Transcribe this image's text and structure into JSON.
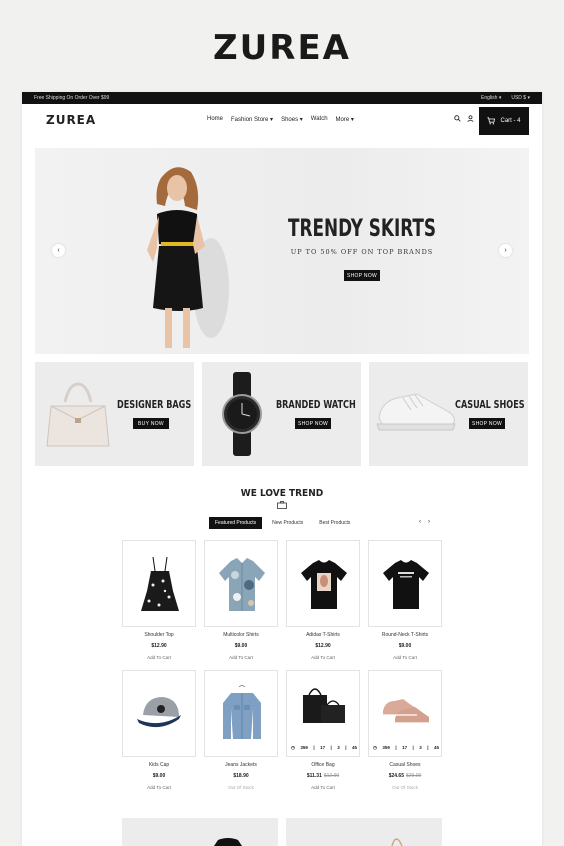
{
  "brand": "ZUREA",
  "topbar": {
    "shipping": "Free Shipping On Order Over $99",
    "language": "English",
    "currency": "USD $"
  },
  "header": {
    "logo": "ZUREA",
    "nav": [
      "Home",
      "Fashion Store",
      "Shoes",
      "Watch",
      "More"
    ],
    "cart_label": "Cart - 4"
  },
  "hero": {
    "title": "TRENDY SKIRTS",
    "subtitle": "UP TO 50% OFF ON TOP BRANDS",
    "button": "SHOP NOW"
  },
  "banners": [
    {
      "title": "DESIGNER BAGS",
      "button": "BUY NOW"
    },
    {
      "title": "BRANDED WATCH",
      "button": "SHOP NOW"
    },
    {
      "title": "CASUAL SHOES",
      "button": "SHOP NOW"
    }
  ],
  "section": {
    "title": "WE LOVE TREND",
    "tabs": [
      "Featured Products",
      "New Products",
      "Best Products"
    ]
  },
  "products": [
    {
      "name": "Shoulder Top",
      "price": "$12.90",
      "old_price": "",
      "action": "Add To Cart"
    },
    {
      "name": "Multicolor Shirts",
      "price": "$9.00",
      "old_price": "",
      "action": "Add To Cart"
    },
    {
      "name": "Adidas T-Shirts",
      "price": "$12.90",
      "old_price": "",
      "action": "Add To Cart"
    },
    {
      "name": "Round-Neck T-Shirts",
      "price": "$9.00",
      "old_price": "",
      "action": "Add To Cart"
    },
    {
      "name": "Kids Cap",
      "price": "$9.00",
      "old_price": "",
      "action": "Add To Cart"
    },
    {
      "name": "Jeans Jackets",
      "price": "$18.90",
      "old_price": "",
      "action": "Out Of Stock"
    },
    {
      "name": "Office Bag",
      "price": "$11.31",
      "old_price": "$12.90",
      "action": "Add To Cart"
    },
    {
      "name": "Casual Shoes",
      "price": "$24.65",
      "old_price": "$29.00",
      "action": "Out Of Stock"
    }
  ],
  "countdowns": {
    "office_bag": [
      "359",
      "17",
      "3",
      "45"
    ],
    "casual_shoes": [
      "359",
      "17",
      "3",
      "45"
    ]
  }
}
